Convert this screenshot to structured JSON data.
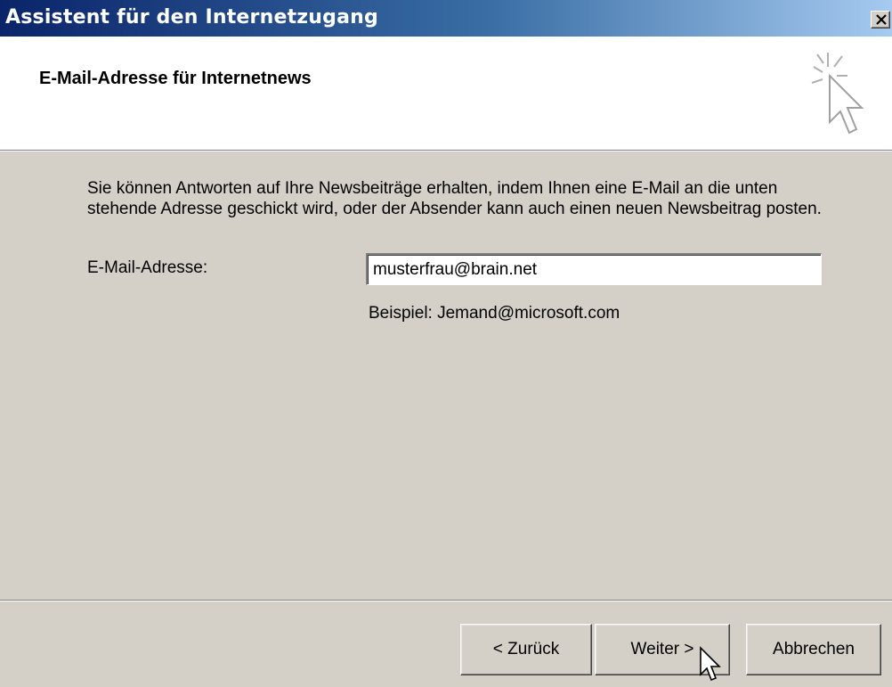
{
  "window": {
    "title": "Assistent für den Internetzugang",
    "close_icon": "close-icon"
  },
  "header": {
    "title": "E-Mail-Adresse für Internetnews",
    "icon": "wizard-sparkle-cursor-icon"
  },
  "body": {
    "description": "Sie können Antworten auf Ihre Newsbeiträge erhalten, indem Ihnen eine E-Mail an die unten stehende Adresse geschickt wird, oder der Absender kann auch einen neuen Newsbeitrag posten.",
    "email_label": "E-Mail-Adresse:",
    "email_value": "musterfrau@brain.net",
    "example": "Beispiel: Jemand@microsoft.com"
  },
  "buttons": {
    "back": "< Zurück",
    "next": "Weiter >",
    "cancel": "Abbrechen"
  },
  "colors": {
    "titlebar_start": "#0a246a",
    "titlebar_end": "#a6caf0",
    "dialog_bg": "#d4d0c8"
  }
}
